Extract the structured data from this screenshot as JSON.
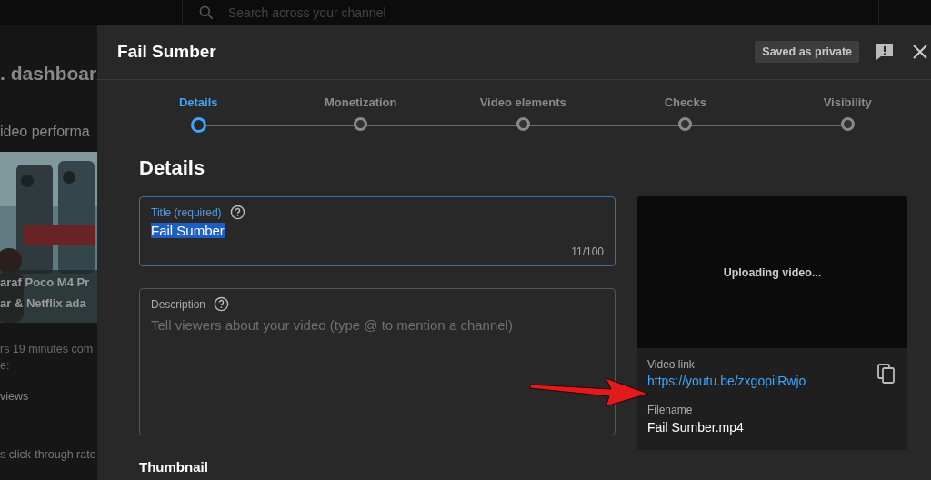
{
  "background": {
    "search_placeholder": "Search across your channel",
    "heading": ". dashboar",
    "section": "ideo performa",
    "video_title_lines": [
      "araf Poco M4 Pr",
      "ar & Netflix ada"
    ],
    "lines": [
      "rs 19 minutes com",
      "e:",
      "views",
      "s click-through rate"
    ]
  },
  "dialog": {
    "title": "Fail Sumber",
    "save_status": "Saved as private"
  },
  "steps": [
    {
      "label": "Details",
      "selected": true
    },
    {
      "label": "Monetization",
      "selected": false
    },
    {
      "label": "Video elements",
      "selected": false
    },
    {
      "label": "Checks",
      "selected": false
    },
    {
      "label": "Visibility",
      "selected": false
    }
  ],
  "details": {
    "heading": "Details",
    "title_field": {
      "label": "Title (required)",
      "value": "Fail Sumber",
      "counter": "11/100"
    },
    "description_field": {
      "label": "Description",
      "placeholder": "Tell viewers about your video (type @ to mention a channel)"
    },
    "thumbnail_heading": "Thumbnail"
  },
  "preview": {
    "status": "Uploading video...",
    "link_label": "Video link",
    "link": "https://youtu.be/zxgopilRwjo",
    "filename_label": "Filename",
    "filename": "Fail Sumber.mp4"
  }
}
